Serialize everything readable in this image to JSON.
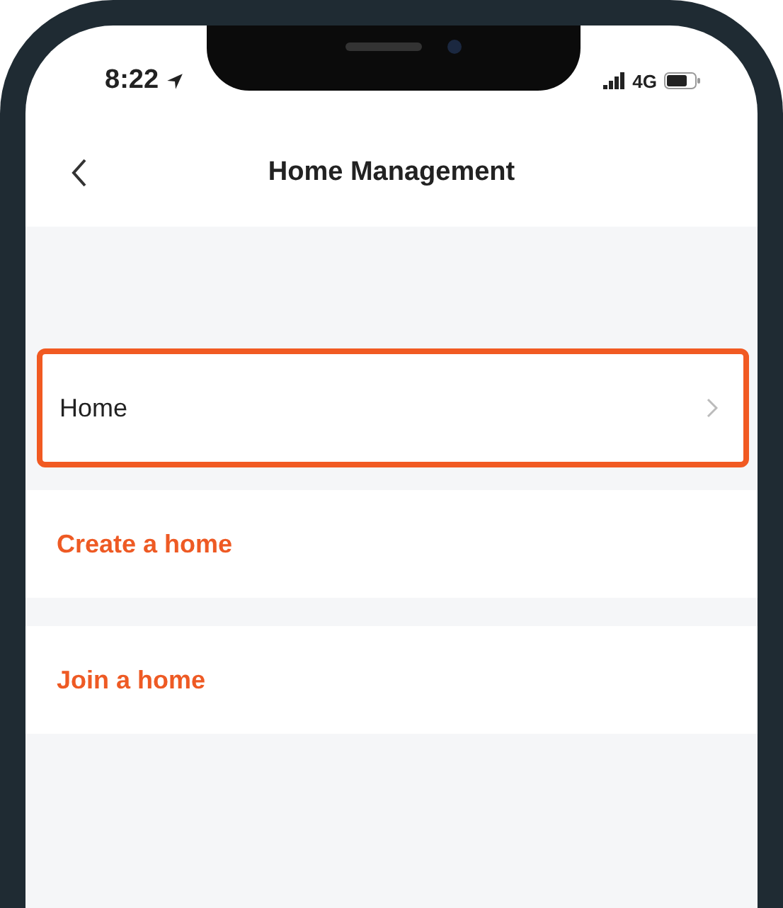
{
  "status_bar": {
    "time": "8:22",
    "network": "4G"
  },
  "nav_bar": {
    "title": "Home Management"
  },
  "items": [
    {
      "label": "Home",
      "kind": "home",
      "highlighted": true
    },
    {
      "label": "Create a home",
      "kind": "action",
      "highlighted": false
    },
    {
      "label": "Join a home",
      "kind": "action",
      "highlighted": false
    }
  ]
}
